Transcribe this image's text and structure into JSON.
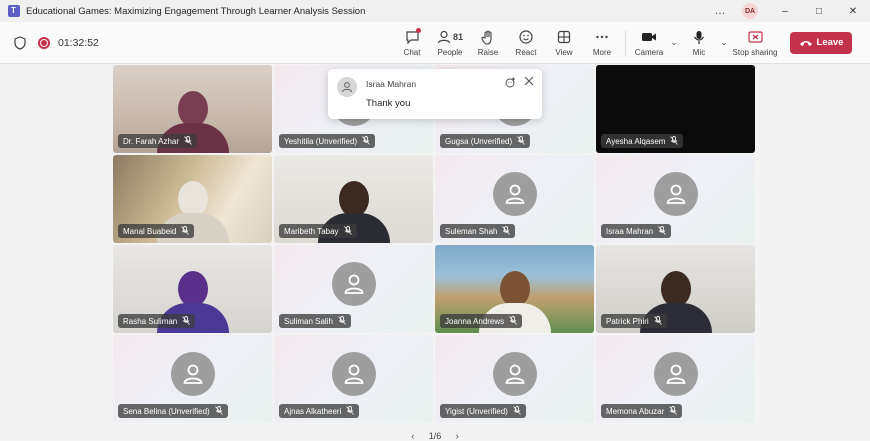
{
  "window": {
    "title": "Educational Games: Maximizing Engagement Through Learner Analysis Session",
    "more_icon": "…",
    "user_initials": "DA",
    "minimize": "–",
    "maximize": "□",
    "close": "✕"
  },
  "toolbar": {
    "timer": "01:32:52",
    "chat_label": "Chat",
    "people_label": "People",
    "people_count": "81",
    "raise_label": "Raise",
    "react_label": "React",
    "view_label": "View",
    "more_label": "More",
    "camera_label": "Camera",
    "mic_label": "Mic",
    "stop_sharing_label": "Stop sharing",
    "leave_label": "Leave",
    "chevron": "⌄"
  },
  "notification": {
    "sender": "Israa Mahran",
    "message": "Thank you"
  },
  "participants": [
    {
      "name": "Dr. Farah Azhar",
      "video": "farah"
    },
    {
      "name": "Yeshitila (Unverified)",
      "video": ""
    },
    {
      "name": "Gugsa (Unverified)",
      "video": ""
    },
    {
      "name": "Ayesha Alqasem",
      "video": "black"
    },
    {
      "name": "Manal Buabeid",
      "video": "manal"
    },
    {
      "name": "Maribeth Tabay",
      "video": "maribeth"
    },
    {
      "name": "Suleman Shah",
      "video": ""
    },
    {
      "name": "Israa Mahran",
      "video": ""
    },
    {
      "name": "Rasha Suliman",
      "video": "rasha"
    },
    {
      "name": "Suliman Salih",
      "video": ""
    },
    {
      "name": "Joanna Andrews",
      "video": "joanna"
    },
    {
      "name": "Patrick Phiri",
      "video": "patrick"
    },
    {
      "name": "Sena Belina (Unverified)",
      "video": ""
    },
    {
      "name": "Ajnas Alkatheeri",
      "video": ""
    },
    {
      "name": "Yigist (Unverified)",
      "video": ""
    },
    {
      "name": "Memona Abuzar",
      "video": ""
    }
  ],
  "pager": {
    "prev": "‹",
    "page": "1/6",
    "next": "›"
  },
  "colors": {
    "leave_red": "#c4314b",
    "teams_purple": "#5b5fc7"
  }
}
